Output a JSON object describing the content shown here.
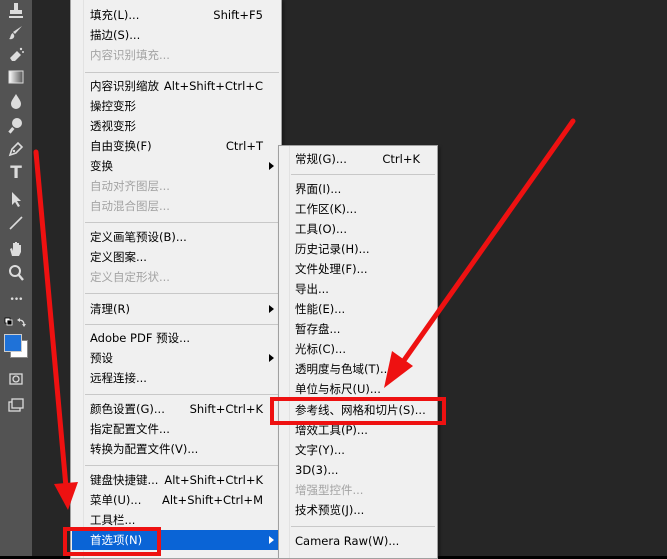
{
  "toolbar": {
    "tools": [
      "stamp-icon",
      "brush-icon",
      "eraser-icon",
      "gradient-icon",
      "blur-drop-icon",
      "dodge-icon",
      "pen-icon",
      "type-icon",
      "path-select-icon",
      "line-icon",
      "hand-icon",
      "zoom-icon",
      "more-icon",
      "default-colors-icon",
      "swatches-icon",
      "quick-mask-icon",
      "screen-mode-icon"
    ],
    "type_tool_glyph": "T",
    "more_glyph": "•••",
    "foreground_color": "#1f72d8",
    "background_color": "#ffffff"
  },
  "edit_menu": {
    "items": [
      {
        "label": "填充(L)...",
        "shortcut": "Shift+F5"
      },
      {
        "label": "描边(S)..."
      },
      {
        "label": "内容识别填充...",
        "disabled": true
      },
      {
        "label": "内容识别缩放",
        "shortcut": "Alt+Shift+Ctrl+C"
      },
      {
        "label": "操控变形"
      },
      {
        "label": "透视变形"
      },
      {
        "label": "自由变换(F)",
        "shortcut": "Ctrl+T"
      },
      {
        "label": "变换",
        "submenu": true
      },
      {
        "label": "自动对齐图层...",
        "disabled": true
      },
      {
        "label": "自动混合图层...",
        "disabled": true
      },
      {
        "label": "定义画笔预设(B)..."
      },
      {
        "label": "定义图案..."
      },
      {
        "label": "定义自定形状...",
        "disabled": true
      },
      {
        "label": "清理(R)",
        "submenu": true
      },
      {
        "label": "Adobe PDF 预设..."
      },
      {
        "label": "预设",
        "submenu": true
      },
      {
        "label": "远程连接..."
      },
      {
        "label": "颜色设置(G)...",
        "shortcut": "Shift+Ctrl+K"
      },
      {
        "label": "指定配置文件..."
      },
      {
        "label": "转换为配置文件(V)..."
      },
      {
        "label": "键盘快捷键...",
        "shortcut": "Alt+Shift+Ctrl+K"
      },
      {
        "label": "菜单(U)...",
        "shortcut": "Alt+Shift+Ctrl+M"
      },
      {
        "label": "工具栏..."
      },
      {
        "label": "首选项(N)",
        "submenu": true,
        "highlighted": true
      }
    ]
  },
  "preferences_submenu": {
    "items": [
      {
        "label": "常规(G)...",
        "shortcut": "Ctrl+K"
      },
      {
        "label": "界面(I)..."
      },
      {
        "label": "工作区(K)..."
      },
      {
        "label": "工具(O)..."
      },
      {
        "label": "历史记录(H)..."
      },
      {
        "label": "文件处理(F)..."
      },
      {
        "label": "导出..."
      },
      {
        "label": "性能(E)..."
      },
      {
        "label": "暂存盘..."
      },
      {
        "label": "光标(C)..."
      },
      {
        "label": "透明度与色域(T)..."
      },
      {
        "label": "单位与标尺(U)..."
      },
      {
        "label": "参考线、网格和切片(S)..."
      },
      {
        "label": "增效工具(P)..."
      },
      {
        "label": "文字(Y)..."
      },
      {
        "label": "3D(3)..."
      },
      {
        "label": "增强型控件...",
        "disabled": true
      },
      {
        "label": "技术预览(J)..."
      },
      {
        "label": "Camera Raw(W)..."
      }
    ]
  },
  "annotation_color": "#ee1111"
}
